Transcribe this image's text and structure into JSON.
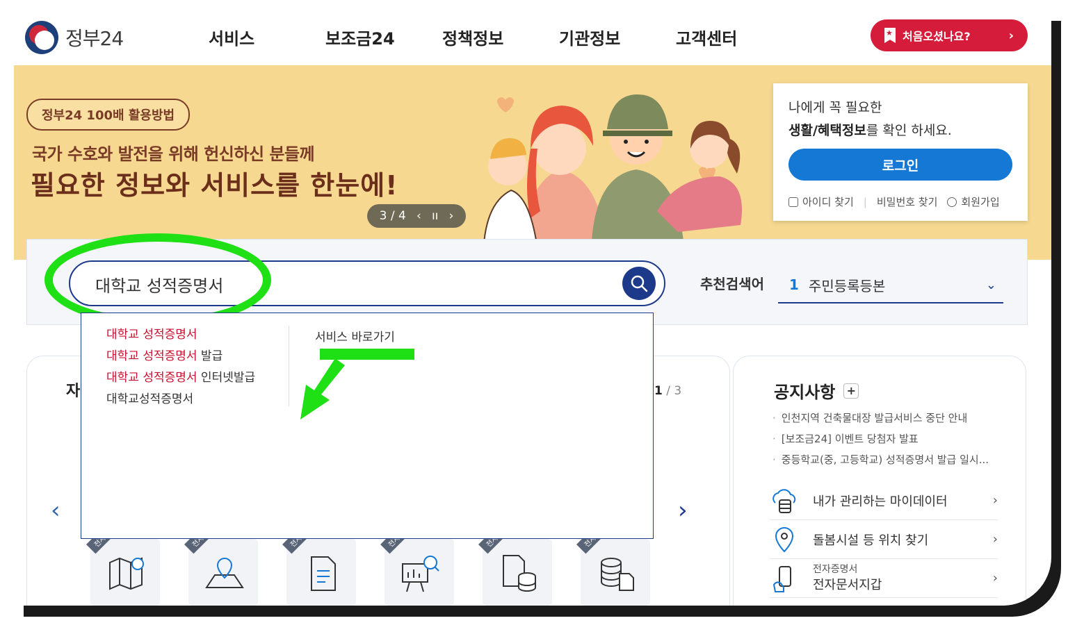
{
  "header": {
    "logo_text": "정부24",
    "nav": [
      "서비스",
      "보조금24",
      "정책정보",
      "기관정보",
      "고객센터"
    ],
    "first_visit_button": "처음오셨나요?"
  },
  "hero": {
    "badge": "정부24 100배 활용방법",
    "subtitle": "국가 수호와 발전을 위해 헌신하신 분들께",
    "title": "필요한 정보와 서비스를 한눈에!",
    "slide_indicator": "3 / 4"
  },
  "login": {
    "message_line1": "나에게 꼭 필요한",
    "message_bold": "생활/혜택정보",
    "message_line2_rest": "를 확인 하세요.",
    "login_button": "로그인",
    "find_id": "아이디 찾기",
    "find_password": "비밀번호 찾기",
    "signup": "회원가입"
  },
  "search": {
    "query": "대학교 성적증명서",
    "recommended_label": "추천검색어",
    "recommended_rank": "1",
    "recommended_term": "주민등록등본"
  },
  "autocomplete": {
    "items": [
      {
        "highlight": "대학교 성적증명서",
        "rest": ""
      },
      {
        "highlight": "대학교 성적증명서",
        "rest": " 발급"
      },
      {
        "highlight": "대학교 성적증명서",
        "rest": " 인터넷발급"
      },
      {
        "highlight": "",
        "rest": "대학교성적증명서"
      }
    ],
    "shortcut_label": "서비스 바로가기"
  },
  "services_card": {
    "title_partial": "자",
    "page_current": "1",
    "page_total": "/ 3",
    "tag": "전자증명",
    "icons": [
      "map-icon",
      "location-map-icon",
      "document-icon",
      "chart-search-icon",
      "document-database-icon",
      "database-document-icon"
    ]
  },
  "notice": {
    "title": "공지사항",
    "items": [
      "인천지역 건축물대장 발급서비스 중단 안내",
      "[보조금24] 이벤트 당첨자 발표",
      "중등학교(중, 고등학교) 성적증명서 발급 일시..."
    ]
  },
  "quick_links": [
    {
      "label": "내가 관리하는 마이데이터",
      "sub": "",
      "icon": "cloud-database-icon"
    },
    {
      "label": "돌봄시설 등 위치 찾기",
      "sub": "",
      "icon": "location-pin-icon"
    },
    {
      "label": "전자문서지갑",
      "sub": "전자증명서",
      "icon": "phone-hand-icon"
    }
  ],
  "colors": {
    "brand_navy": "#1d3a8a",
    "brand_red": "#d61c3b",
    "login_blue": "#1478d4",
    "hero_bg": "#f6d891",
    "annotation_green": "#1ee014"
  }
}
